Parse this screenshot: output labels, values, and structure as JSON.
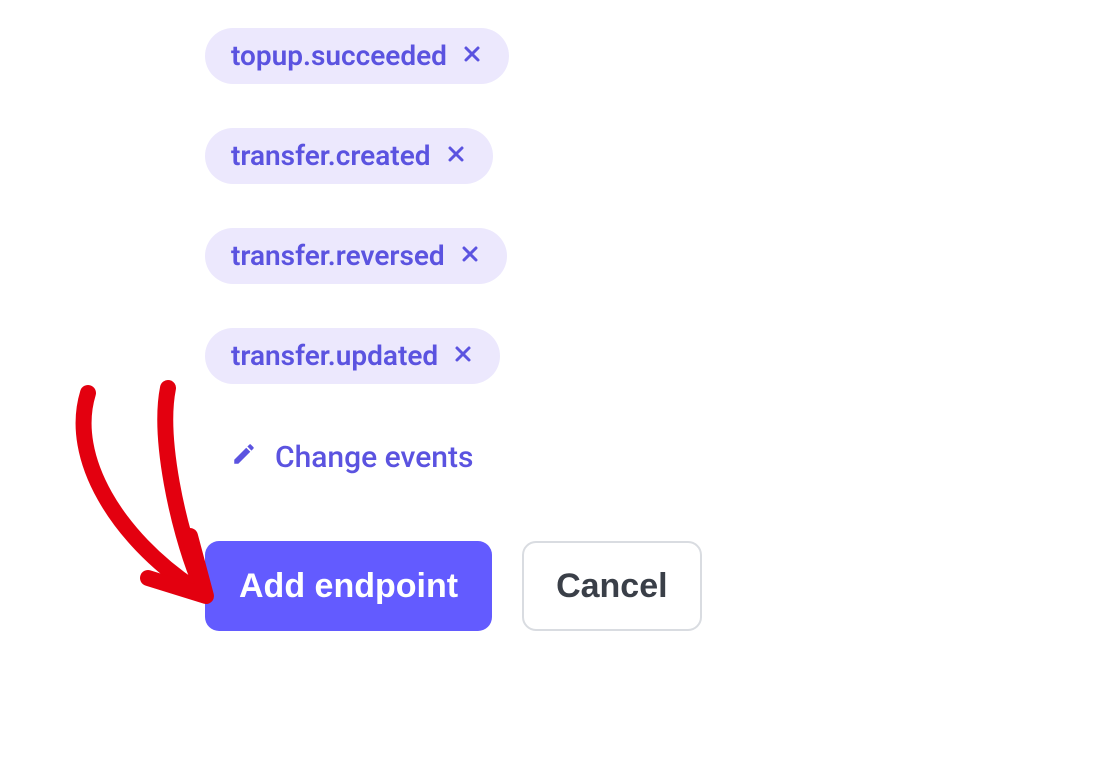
{
  "events": [
    {
      "name": "topup.succeeded"
    },
    {
      "name": "transfer.created"
    },
    {
      "name": "transfer.reversed"
    },
    {
      "name": "transfer.updated"
    }
  ],
  "change_link_label": "Change events",
  "buttons": {
    "primary_label": "Add endpoint",
    "secondary_label": "Cancel"
  },
  "annotation": {
    "arrow_color": "#e3000f"
  }
}
